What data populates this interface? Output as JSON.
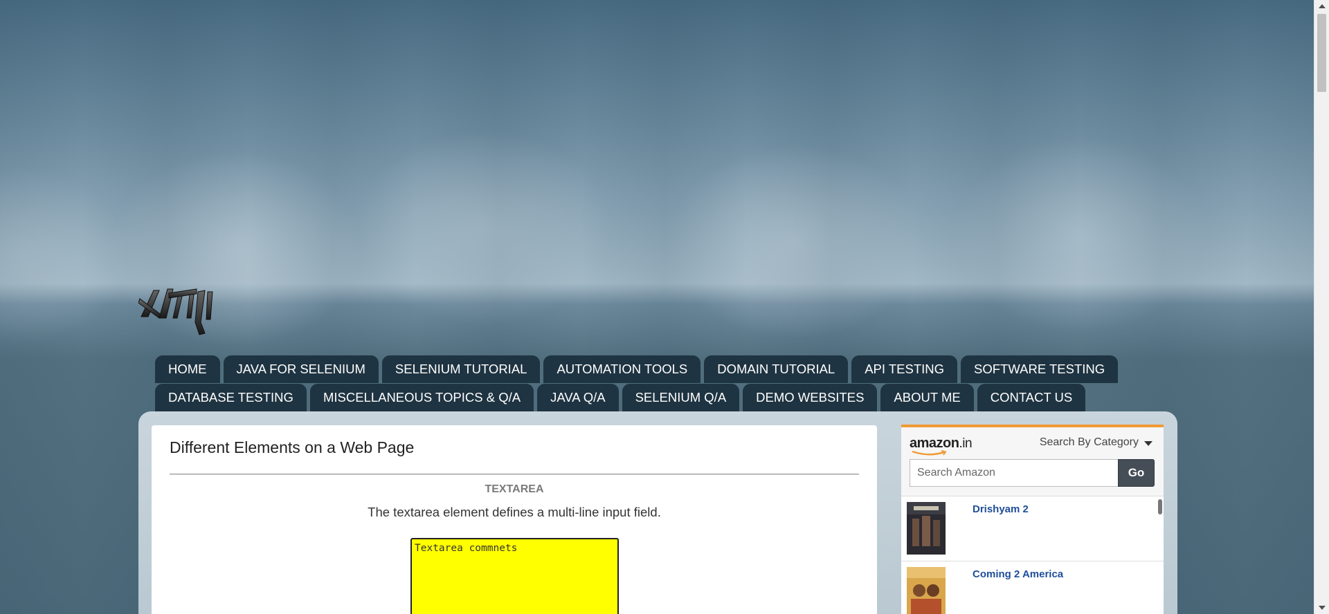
{
  "nav": {
    "row1": [
      "HOME",
      "JAVA FOR SELENIUM",
      "SELENIUM TUTORIAL",
      "AUTOMATION TOOLS",
      "DOMAIN TUTORIAL",
      "API TESTING",
      "SOFTWARE TESTING"
    ],
    "row2": [
      "DATABASE TESTING",
      "MISCELLANEOUS TOPICS & Q/A",
      "JAVA Q/A",
      "SELENIUM Q/A",
      "DEMO WEBSITES",
      "ABOUT ME",
      "CONTACT US"
    ]
  },
  "post": {
    "title": "Different Elements on a Web Page",
    "section_heading": "TEXTAREA",
    "description": "The textarea element defines a multi-line input field.",
    "textarea_value": "Textarea commnets"
  },
  "amazon": {
    "logo": "amazon",
    "logo_tld": ".in",
    "category_label": "Search By Category",
    "search_placeholder": "Search Amazon",
    "go_label": "Go",
    "items": [
      {
        "title": "Drishyam 2"
      },
      {
        "title": "Coming 2 America"
      }
    ]
  },
  "colors": {
    "nav_tab": "#1f3442",
    "textarea_bg": "#ffff00",
    "amazon_accent": "#f09a36",
    "product_link": "#1f4e99"
  }
}
